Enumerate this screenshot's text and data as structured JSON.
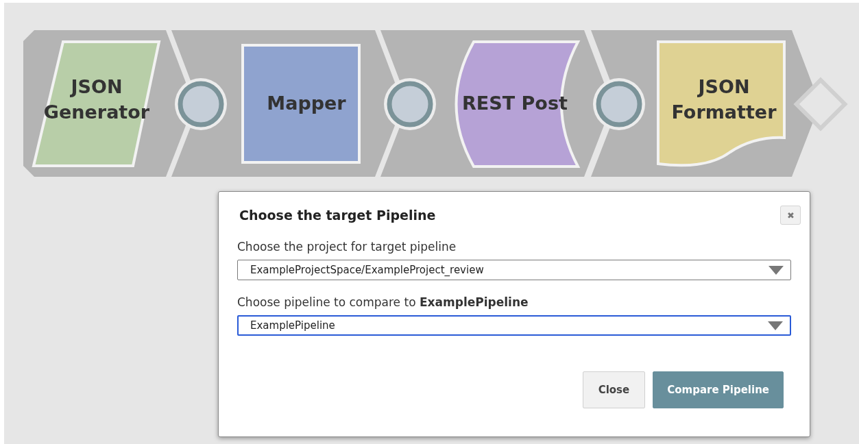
{
  "pipeline": {
    "snaps": [
      {
        "kind": "parallelogram",
        "lines": [
          "JSON",
          "Generator"
        ],
        "color": "#b8cea8"
      },
      {
        "kind": "square",
        "lines": [
          "Mapper"
        ],
        "color": "#8fa3cf"
      },
      {
        "kind": "curved",
        "lines": [
          "REST Post"
        ],
        "color": "#b6a2d6"
      },
      {
        "kind": "document",
        "lines": [
          "JSON",
          "Formatter"
        ],
        "color": "#dfd293"
      }
    ]
  },
  "dialog": {
    "title": "Choose the target Pipeline",
    "close_icon": "✖",
    "fields": [
      {
        "label": "Choose the project for target pipeline",
        "value": "ExampleProjectSpace/ExampleProject_review",
        "focused": false
      },
      {
        "label": "Choose pipeline to compare to **ExamplePipeline**",
        "value": "ExamplePipeline",
        "focused": true
      }
    ],
    "buttons": [
      {
        "label": "Close",
        "kind": "secondary"
      },
      {
        "label": "Compare Pipeline",
        "kind": "primary"
      }
    ]
  }
}
